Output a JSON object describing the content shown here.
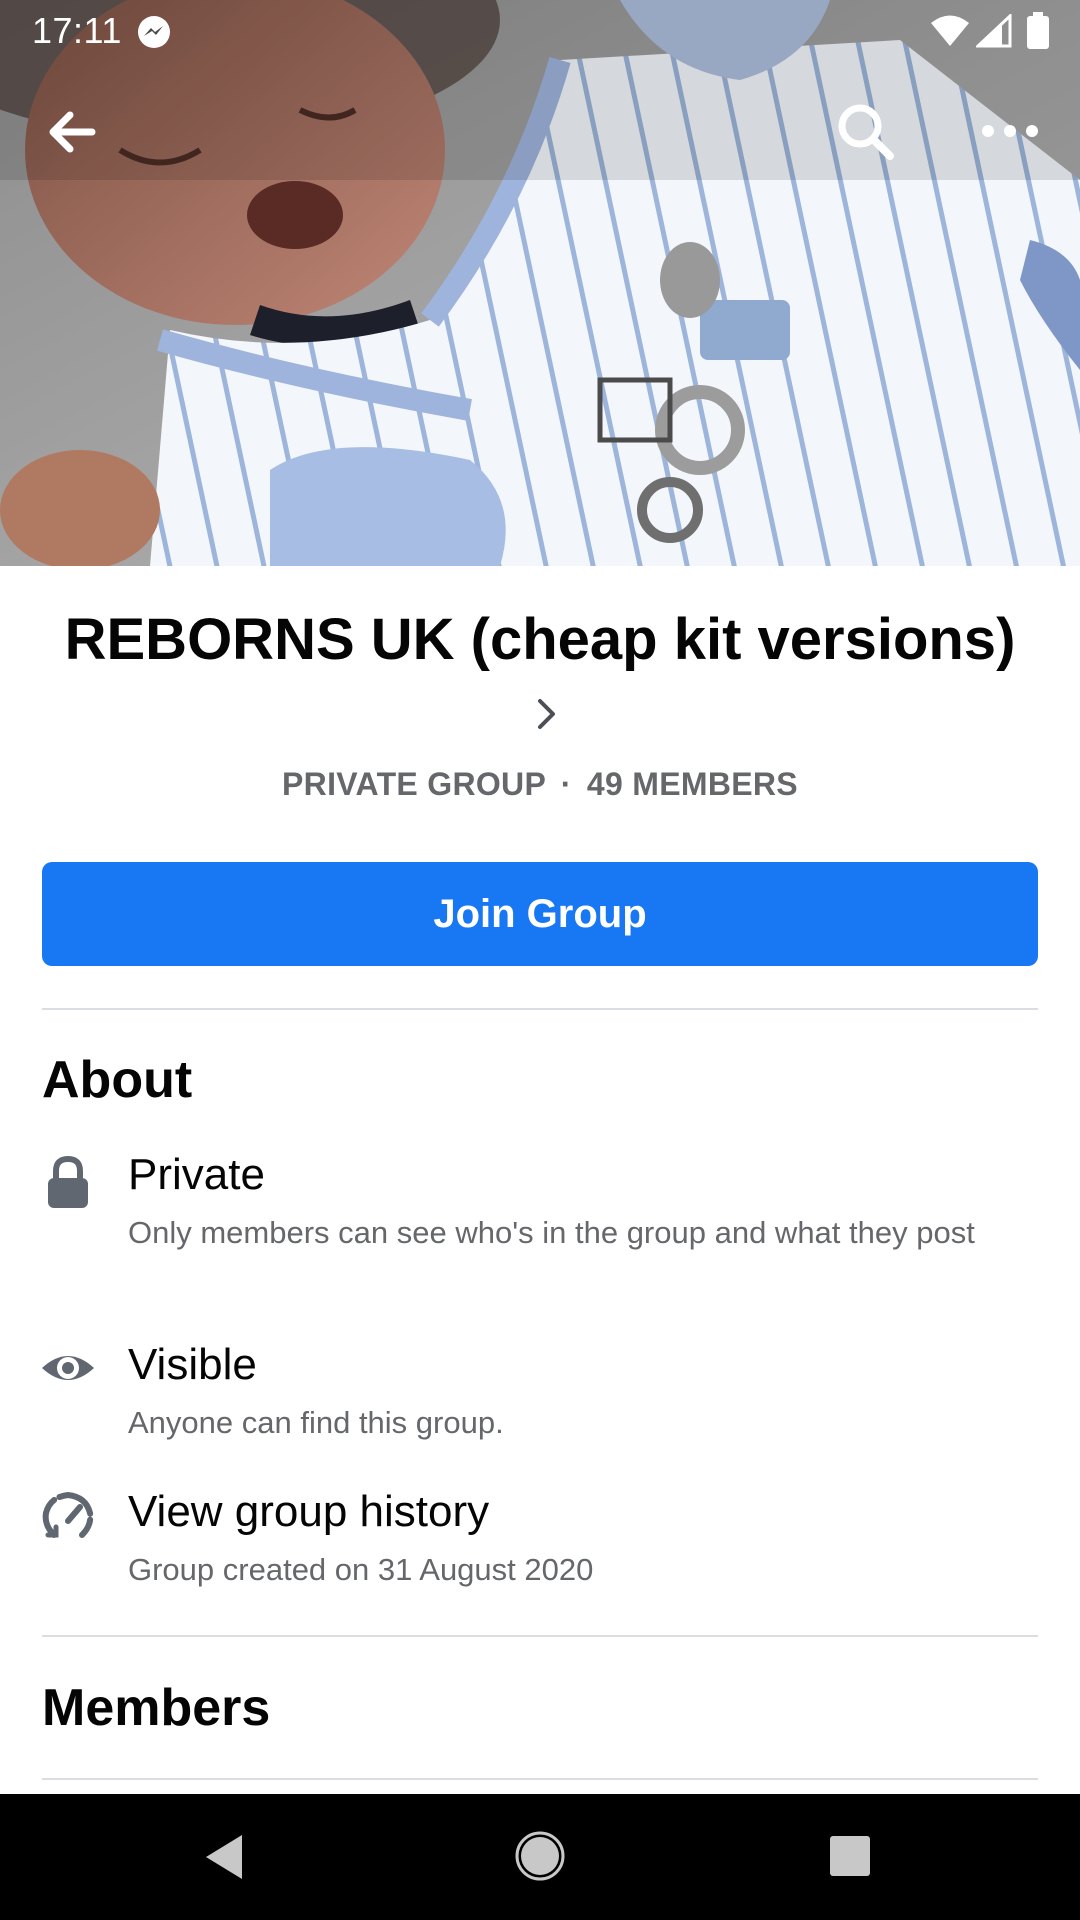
{
  "status_bar": {
    "time": "17:11",
    "icons": [
      "messenger-icon",
      "wifi-icon",
      "signal-icon",
      "battery-icon"
    ]
  },
  "top_actions": {
    "icons": [
      "back-arrow-icon",
      "search-icon",
      "more-options-icon"
    ]
  },
  "group": {
    "title": "REBORNS UK (cheap kit versions)",
    "privacy_label": "PRIVATE GROUP",
    "separator": "·",
    "members_label": "49 MEMBERS",
    "join_button_label": "Join Group"
  },
  "about": {
    "heading": "About",
    "items": [
      {
        "icon": "lock-icon",
        "title": "Private",
        "description": "Only members can see who's in the group and what they post"
      },
      {
        "icon": "eye-icon",
        "title": "Visible",
        "description": "Anyone can find this group."
      },
      {
        "icon": "history-icon",
        "title": "View group history",
        "description": "Group created on 31 August 2020"
      }
    ]
  },
  "members": {
    "heading": "Members"
  },
  "nav_bar": {
    "icons": [
      "nav-back-icon",
      "nav-home-icon",
      "nav-recents-icon"
    ]
  },
  "colors": {
    "primary_blue": "#1877f2",
    "text_primary": "#050505",
    "text_secondary": "#65676b",
    "divider": "#dadde1",
    "icon_gray": "#606770"
  }
}
